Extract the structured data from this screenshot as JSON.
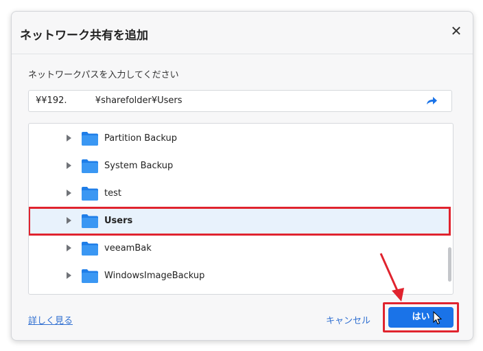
{
  "dialog": {
    "title": "ネットワーク共有を追加",
    "close_icon": "close-icon"
  },
  "prompt": "ネットワークパスを入力してください",
  "path_input": {
    "value": "¥¥192.          ¥sharefolder¥Users",
    "go_icon": "redo-arrow-icon"
  },
  "tree": {
    "items": [
      {
        "label": "Partition Backup"
      },
      {
        "label": "System Backup"
      },
      {
        "label": "test"
      },
      {
        "label": "Users"
      },
      {
        "label": "veeamBak"
      },
      {
        "label": "WindowsImageBackup"
      }
    ],
    "selected_label": "Users"
  },
  "footer": {
    "more_link": "詳しく見る",
    "cancel_label": "キャンセル",
    "ok_label": "はい"
  },
  "colors": {
    "accent": "#1a73e8",
    "folder": "#2f8ef0",
    "highlight": "#e0232e",
    "selected_row": "#e8f2fc"
  }
}
